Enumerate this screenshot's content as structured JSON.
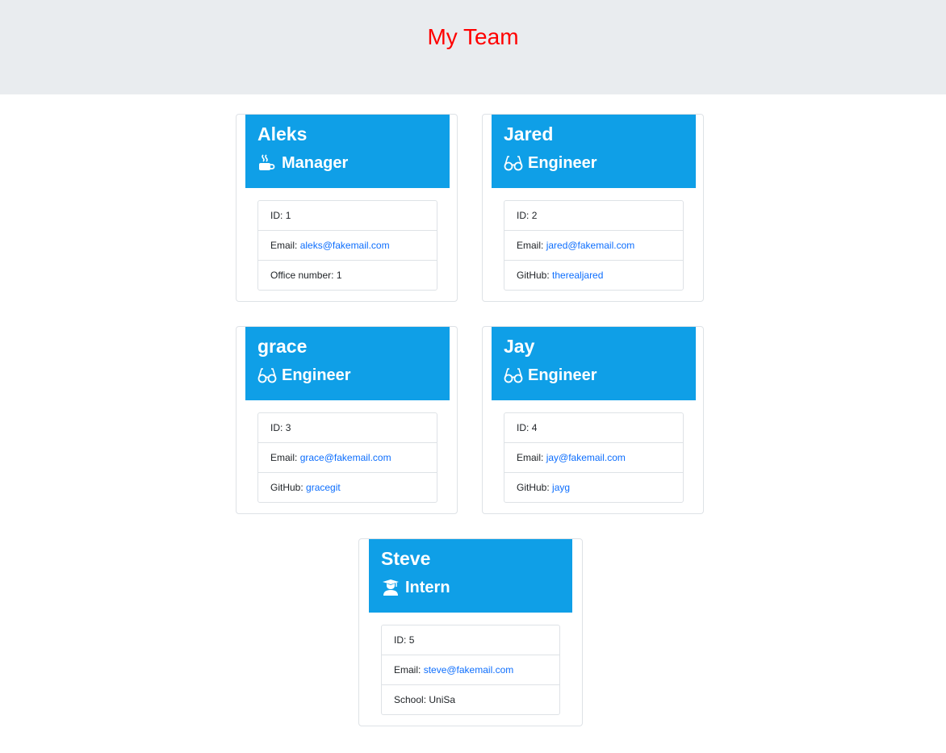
{
  "header": {
    "title": "My Team"
  },
  "colors": {
    "title": "#ff0000",
    "card_header": "#0f9fe7",
    "link": "#0d6efd",
    "header_bg": "#e9ecef"
  },
  "cards": [
    {
      "name": "Aleks",
      "role": "Manager",
      "icon": "coffee-icon",
      "id_label": "ID:",
      "id": "1",
      "email_label": "Email:",
      "email": "aleks@fakemail.com",
      "extra_label": "Office number:",
      "extra": "1"
    },
    {
      "name": "Jared",
      "role": "Engineer",
      "icon": "glasses-icon",
      "id_label": "ID:",
      "id": "2",
      "email_label": "Email:",
      "email": "jared@fakemail.com",
      "extra_label": "GitHub:",
      "extra": "therealjared"
    },
    {
      "name": "grace",
      "role": "Engineer",
      "icon": "glasses-icon",
      "id_label": "ID:",
      "id": "3",
      "email_label": "Email:",
      "email": "grace@fakemail.com",
      "extra_label": "GitHub:",
      "extra": "gracegit"
    },
    {
      "name": "Jay",
      "role": "Engineer",
      "icon": "glasses-icon",
      "id_label": "ID:",
      "id": "4",
      "email_label": "Email:",
      "email": "jay@fakemail.com",
      "extra_label": "GitHub:",
      "extra": "jayg"
    },
    {
      "name": "Steve",
      "role": "Intern",
      "icon": "graduate-icon",
      "id_label": "ID:",
      "id": "5",
      "email_label": "Email:",
      "email": "steve@fakemail.com",
      "extra_label": "School:",
      "extra": "UniSa"
    }
  ]
}
